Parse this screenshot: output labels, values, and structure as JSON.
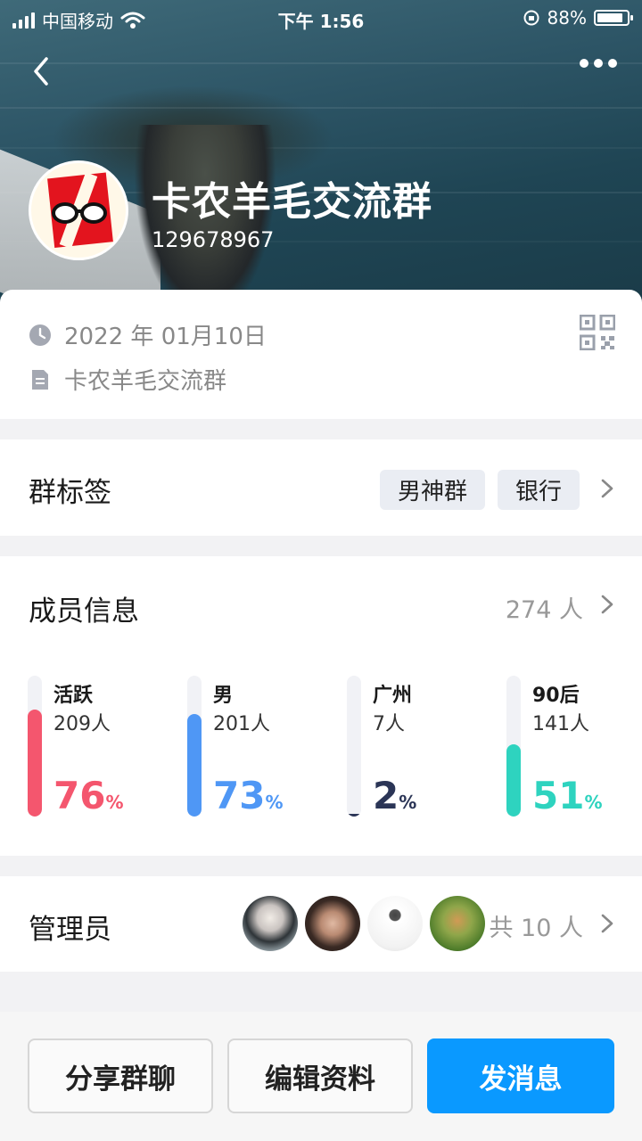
{
  "status_bar": {
    "carrier": "中国移动",
    "time": "下午 1:56",
    "battery": "88%"
  },
  "header": {
    "group_name": "卡农羊毛交流群",
    "group_id": "129678967"
  },
  "info": {
    "created_date": "2022 年 01月10日",
    "description": "卡农羊毛交流群"
  },
  "tags_section": {
    "title": "群标签",
    "tags": [
      "男神群",
      "银行"
    ]
  },
  "members_section": {
    "title": "成员信息",
    "total": "274 人",
    "stats": [
      {
        "label": "活跃",
        "count": "209人",
        "percent": "76",
        "unit": "%",
        "fraction": 0.76,
        "color": "#f4566e"
      },
      {
        "label": "男",
        "count": "201人",
        "percent": "73",
        "unit": "%",
        "fraction": 0.73,
        "color": "#4f97f5"
      },
      {
        "label": "广州",
        "count": "7人",
        "percent": "2",
        "unit": "%",
        "fraction": 0.02,
        "color": "#2b3556"
      },
      {
        "label": "90后",
        "count": "141人",
        "percent": "51",
        "unit": "%",
        "fraction": 0.51,
        "color": "#2ed3bf"
      }
    ]
  },
  "admins_section": {
    "title": "管理员",
    "total": "共 10 人"
  },
  "actions": {
    "share": "分享群聊",
    "edit": "编辑资料",
    "send": "发消息"
  }
}
